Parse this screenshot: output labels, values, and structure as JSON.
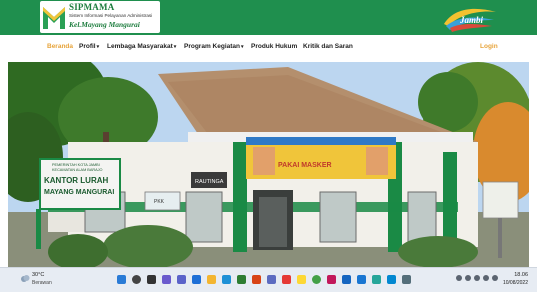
{
  "header": {
    "logo_title": "SIPMAMA",
    "logo_subtitle": "Sistem Informasi Pelayanan Administrasi",
    "logo_kelurahan": "Kel.Mayang Mangurai",
    "brand_logo": "jambi-city-logo"
  },
  "nav": {
    "items": [
      {
        "label": "Beranda",
        "active": true,
        "dropdown": false
      },
      {
        "label": "Profil",
        "active": false,
        "dropdown": true
      },
      {
        "label": "Lembaga Masyarakat",
        "active": false,
        "dropdown": true
      },
      {
        "label": "Program Kegiatan",
        "active": false,
        "dropdown": true
      },
      {
        "label": "Produk Hukum",
        "active": false,
        "dropdown": false
      },
      {
        "label": "Kritik dan Saran",
        "active": false,
        "dropdown": false
      }
    ],
    "login_label": "Login",
    "active_color": "#e7a43b"
  },
  "hero": {
    "office_sign_line1": "PEMERINTAH KOTA JAMBI",
    "office_sign_line2": "KECAMATAN ALAM BARAJO",
    "office_sign_main1": "KANTOR LURAH",
    "office_sign_main2": "MAYANG MANGURAI",
    "door_sign": "RAUTINGA",
    "banner_text": "PAKAI MASKER",
    "small_sign": "PKK"
  },
  "taskbar": {
    "temperature": "30°C",
    "weather": "Berawan",
    "time": "18.06",
    "date": "10/08/2022"
  },
  "colors": {
    "header_green": "#1f8f4e",
    "building_green": "#1a8a45",
    "roof": "#b48f6d"
  }
}
